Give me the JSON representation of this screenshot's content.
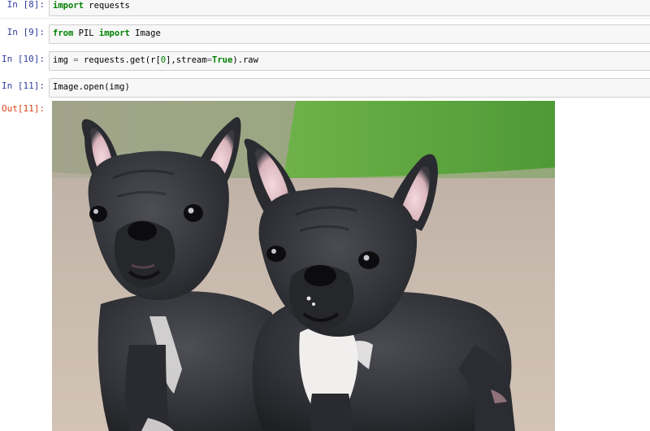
{
  "cells": [
    {
      "prompt": "In  [8]:",
      "code_parts": [
        {
          "text": "import",
          "kind": "kw"
        },
        {
          "text": " requests",
          "kind": "plain"
        }
      ]
    },
    {
      "prompt": "In  [9]:",
      "code_parts": [
        {
          "text": "from",
          "kind": "kw"
        },
        {
          "text": " PIL ",
          "kind": "plain"
        },
        {
          "text": "import",
          "kind": "kw"
        },
        {
          "text": " Image",
          "kind": "plain"
        }
      ]
    },
    {
      "prompt": "In  [10]:",
      "code_parts": [
        {
          "text": "img ",
          "kind": "plain"
        },
        {
          "text": "=",
          "kind": "op"
        },
        {
          "text": " requests.get(r[",
          "kind": "plain"
        },
        {
          "text": "0",
          "kind": "num"
        },
        {
          "text": "],stream",
          "kind": "plain"
        },
        {
          "text": "=",
          "kind": "op"
        },
        {
          "text": "True",
          "kind": "kw"
        },
        {
          "text": ").raw",
          "kind": "plain"
        }
      ]
    },
    {
      "prompt": "In  [11]:",
      "code_parts": [
        {
          "text": "Image.open(img)",
          "kind": "plain"
        }
      ]
    }
  ],
  "output": {
    "prompt": "Out[11]:",
    "image_subject": "two-french-bulldogs"
  },
  "colors": {
    "in_prompt": "#303f9f",
    "out_prompt": "#d84315",
    "keyword": "#008000",
    "cell_bg": "#f7f7f7",
    "cell_border": "#cfcfcf"
  }
}
